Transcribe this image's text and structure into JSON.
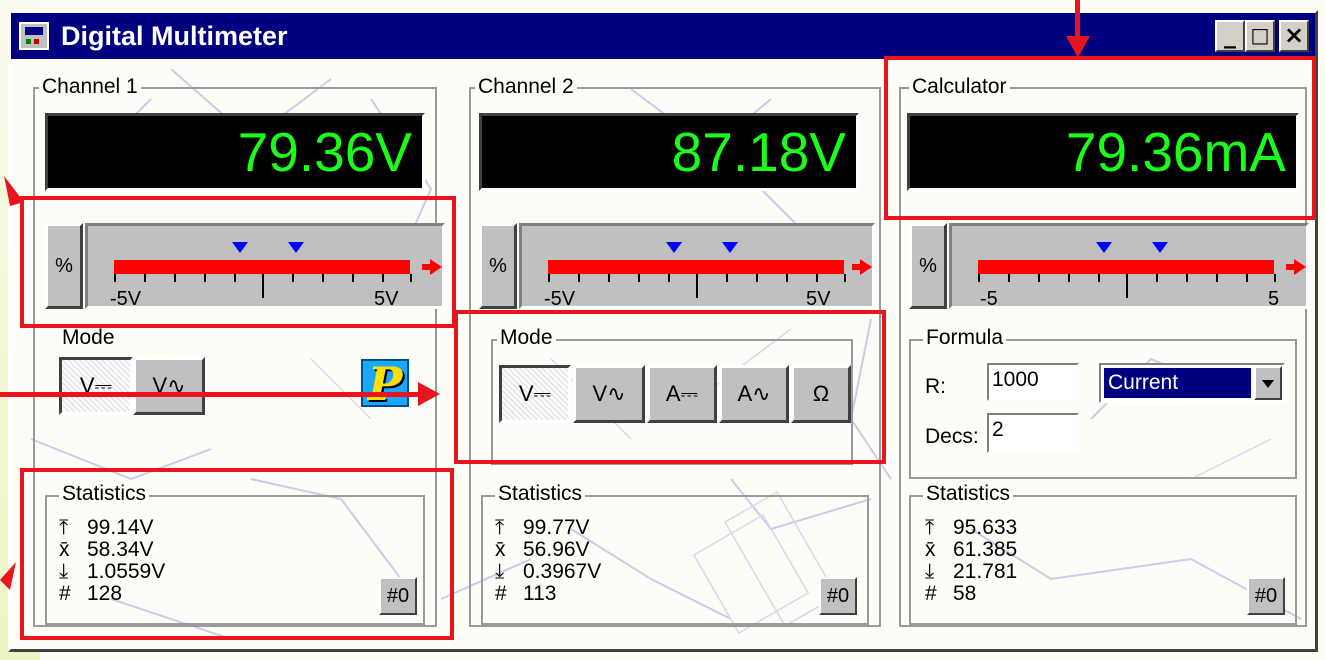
{
  "window": {
    "title": "Digital Multimeter",
    "minimize": "_",
    "maximize": "□",
    "close": "×"
  },
  "colors": {
    "title_bar": "#000080",
    "display_text": "#19ff19",
    "bar": "#ff0000",
    "marker": "#0000ff",
    "annotation": "#e8141e"
  },
  "channel1": {
    "title": "Channel 1",
    "reading": "79.36V",
    "percent_label": "%",
    "scale_min": "-5V",
    "scale_max": "5V",
    "mode_title": "Mode",
    "modes": [
      "V⎓",
      "V∿"
    ],
    "active_mode": 0,
    "probe_icon": "P",
    "stats_title": "Statistics",
    "stats": [
      {
        "icon": "max-icon",
        "symbol": "⤒",
        "value": "99.14V"
      },
      {
        "icon": "mean-icon",
        "symbol": "x̄",
        "value": "58.34V"
      },
      {
        "icon": "min-icon",
        "symbol": "⤓",
        "value": "1.0559V"
      },
      {
        "icon": "count-icon",
        "symbol": "#",
        "value": "128"
      }
    ],
    "reset_label": "#0"
  },
  "channel2": {
    "title": "Channel 2",
    "reading": "87.18V",
    "percent_label": "%",
    "scale_min": "-5V",
    "scale_max": "5V",
    "mode_title": "Mode",
    "modes": [
      "V⎓",
      "V∿",
      "A⎓",
      "A∿",
      "Ω"
    ],
    "active_mode": 0,
    "stats_title": "Statistics",
    "stats": [
      {
        "icon": "max-icon",
        "symbol": "⤒",
        "value": "99.77V"
      },
      {
        "icon": "mean-icon",
        "symbol": "x̄",
        "value": "56.96V"
      },
      {
        "icon": "min-icon",
        "symbol": "⤓",
        "value": "0.3967V"
      },
      {
        "icon": "count-icon",
        "symbol": "#",
        "value": "113"
      }
    ],
    "reset_label": "#0"
  },
  "calculator": {
    "title": "Calculator",
    "reading": "79.36mA",
    "percent_label": "%",
    "scale_min": "-5",
    "scale_max": "5",
    "formula_title": "Formula",
    "r_label": "R:",
    "r_value": "1000",
    "formula_selected": "Current",
    "decs_label": "Decs:",
    "decs_value": "2",
    "stats_title": "Statistics",
    "stats": [
      {
        "icon": "max-icon",
        "symbol": "⤒",
        "value": "95.633"
      },
      {
        "icon": "mean-icon",
        "symbol": "x̄",
        "value": "61.385"
      },
      {
        "icon": "min-icon",
        "symbol": "⤓",
        "value": "21.781"
      },
      {
        "icon": "count-icon",
        "symbol": "#",
        "value": "58"
      }
    ],
    "reset_label": "#0"
  }
}
